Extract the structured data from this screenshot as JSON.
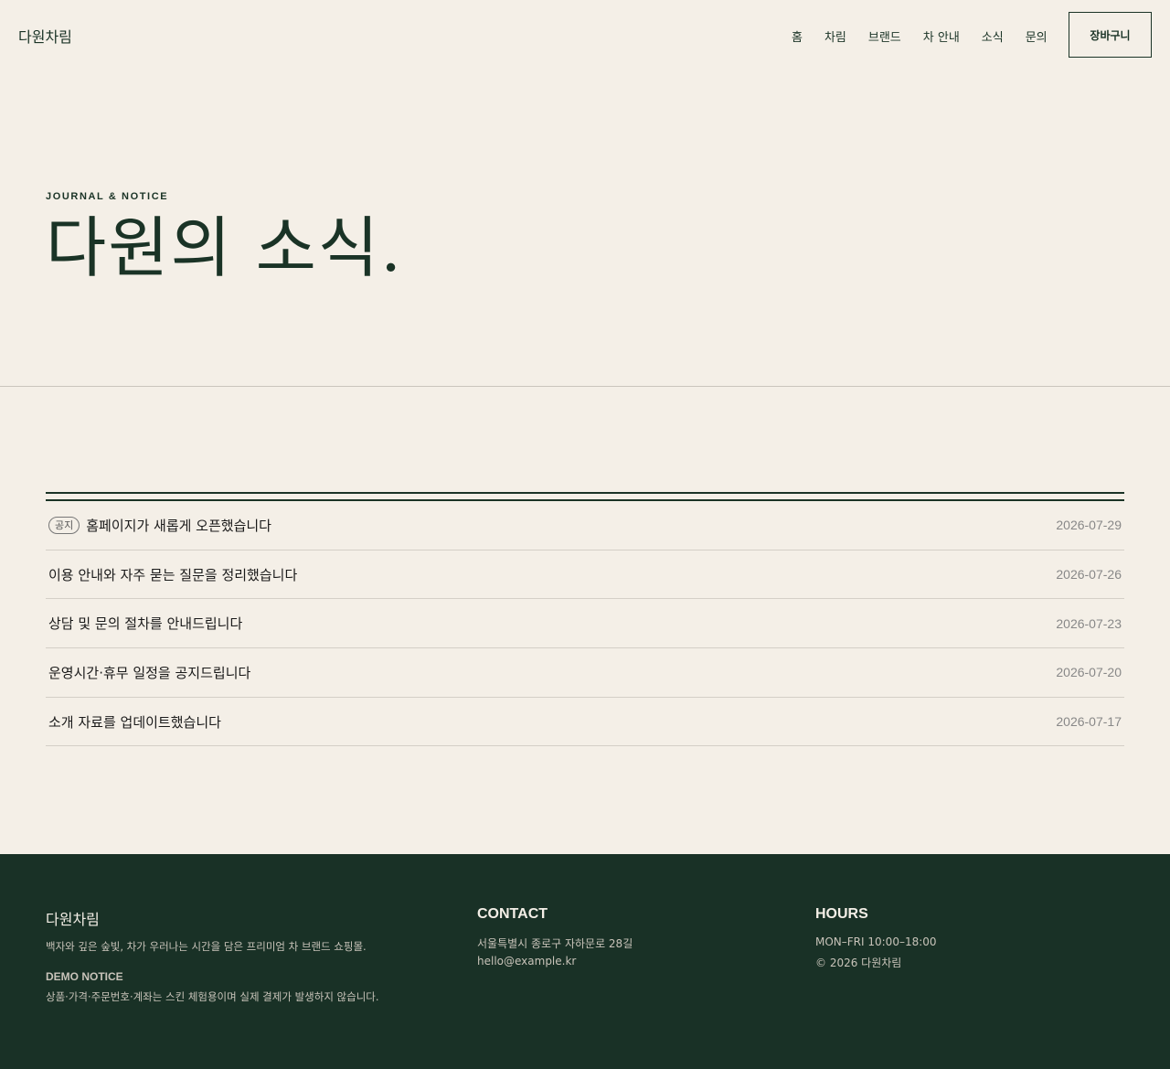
{
  "header": {
    "logo": "다원차림",
    "nav": [
      "홈",
      "차림",
      "브랜드",
      "차 안내",
      "소식",
      "문의"
    ],
    "cart_label": "장바구니"
  },
  "hero": {
    "eyebrow": "JOURNAL & NOTICE",
    "title": "다원의 소식."
  },
  "notices": [
    {
      "badge": "공지",
      "title": "홈페이지가 새롭게 오픈했습니다",
      "date": "2026-07-29"
    },
    {
      "title": "이용 안내와 자주 묻는 질문을 정리했습니다",
      "date": "2026-07-26"
    },
    {
      "title": "상담 및 문의 절차를 안내드립니다",
      "date": "2026-07-23"
    },
    {
      "title": "운영시간·휴무 일정을 공지드립니다",
      "date": "2026-07-20"
    },
    {
      "title": "소개 자료를 업데이트했습니다",
      "date": "2026-07-17"
    }
  ],
  "footer": {
    "brand": "다원차림",
    "description": "백자와 깊은 숲빛, 차가 우러나는 시간을 담은 프리미엄 차 브랜드 쇼핑몰.",
    "notice_heading": "DEMO NOTICE",
    "notice_text": "상품·가격·주문번호·계좌는 스킨 체험용이며 실제 결제가 발생하지 않습니다.",
    "contact_heading": "CONTACT",
    "address": "서울특별시 종로구 자하문로 28길",
    "email": "hello@example.kr",
    "hours_heading": "HOURS",
    "hours": "MON–FRI 10:00–18:00",
    "copyright": "© 2026 다원차림"
  },
  "colors": {
    "background": "#f4efe7",
    "primary": "#1a3326",
    "footer_bg": "#193126"
  }
}
